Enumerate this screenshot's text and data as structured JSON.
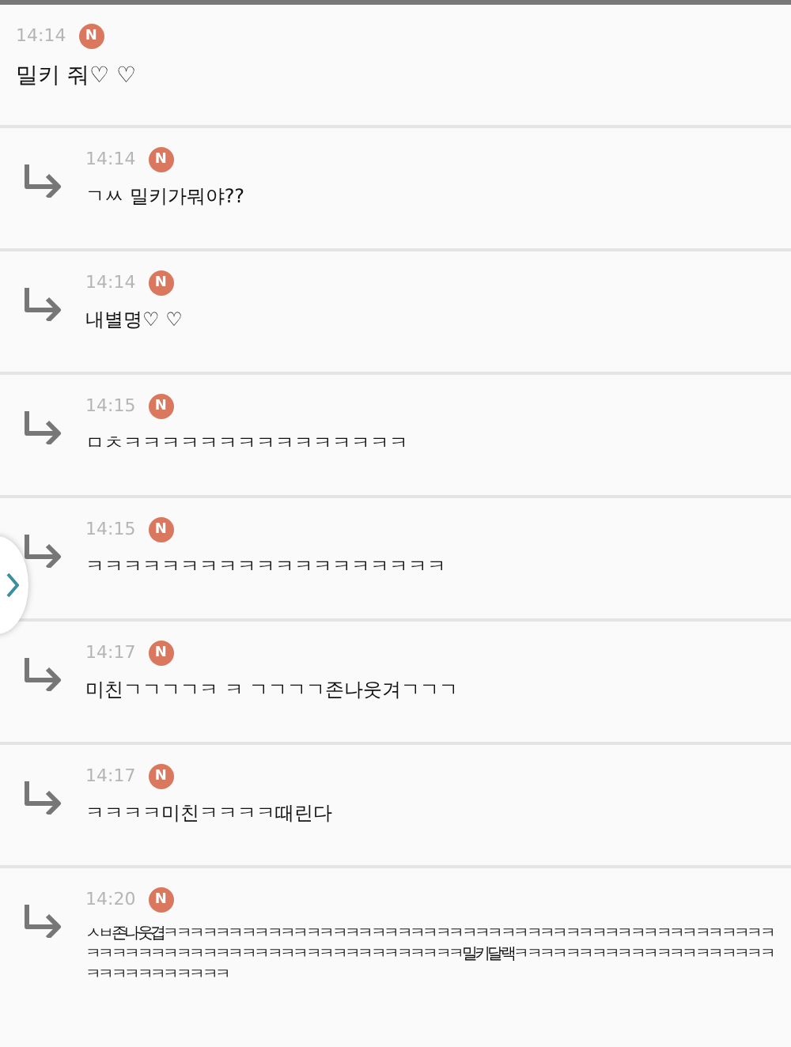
{
  "messages": [
    {
      "kind": "comment",
      "time": "14:14",
      "badge": "N",
      "text": "밀키 줘♡ ♡"
    },
    {
      "kind": "reply",
      "time": "14:14",
      "badge": "N",
      "text": "ㄱㅆ 밀키가뭐야??"
    },
    {
      "kind": "reply",
      "time": "14:14",
      "badge": "N",
      "text": "내별명♡ ♡"
    },
    {
      "kind": "reply",
      "time": "14:15",
      "badge": "N",
      "text": "ㅁㅊㅋㅋㅋㅋㅋㅋㅋㅋㅋㅋㅋㅋㅋㅋㅋ"
    },
    {
      "kind": "reply",
      "time": "14:15",
      "badge": "N",
      "text": "ㅋㅋㅋㅋㅋㅋㅋㅋㅋㅋㅋㅋㅋㅋㅋㅋㅋㅋㅋ"
    },
    {
      "kind": "reply",
      "time": "14:17",
      "badge": "N",
      "text": "미친ㄱㄱㄱㄱㅋ ㅋ ㄱㄱㄱㄱ존나웃겨ㄱㄱㄱ"
    },
    {
      "kind": "reply",
      "time": "14:17",
      "badge": "N",
      "text": "ㅋㅋㅋㅋ미친ㅋㅋㅋㅋ때린다"
    },
    {
      "kind": "reply",
      "time": "14:20",
      "badge": "N",
      "text": "ㅅㅂ존나웃겹ㅋㅋㅋㅋㅋㅋㅋㅋㅋㅋㅋㅋㅋㅋㅋㅋㅋㅋㅋㅋㅋㅋㅋㅋㅋㅋㅋㅋㅋㅋㅋㅋㅋㅋㅋㅋㅋㅋㅋㅋㅋㅋㅋㅋㅋㅋㅋㅋㅋㅋㅋㅋㅋㅋㅋㅋㅋㅋㅋㅋㅋㅋㅋㅋㅋㅋㅋㅋㅋㅋㅋㅋㅋㅋㅋㅋ밀키달랙ㅋㅋㅋㅋㅋㅋㅋㅋㅋㅋㅋㅋㅋㅋㅋㅋㅋㅋㅋㅋㅋㅋㅋㅋㅋㅋㅋㅋㅋㅋㅋ"
    }
  ]
}
